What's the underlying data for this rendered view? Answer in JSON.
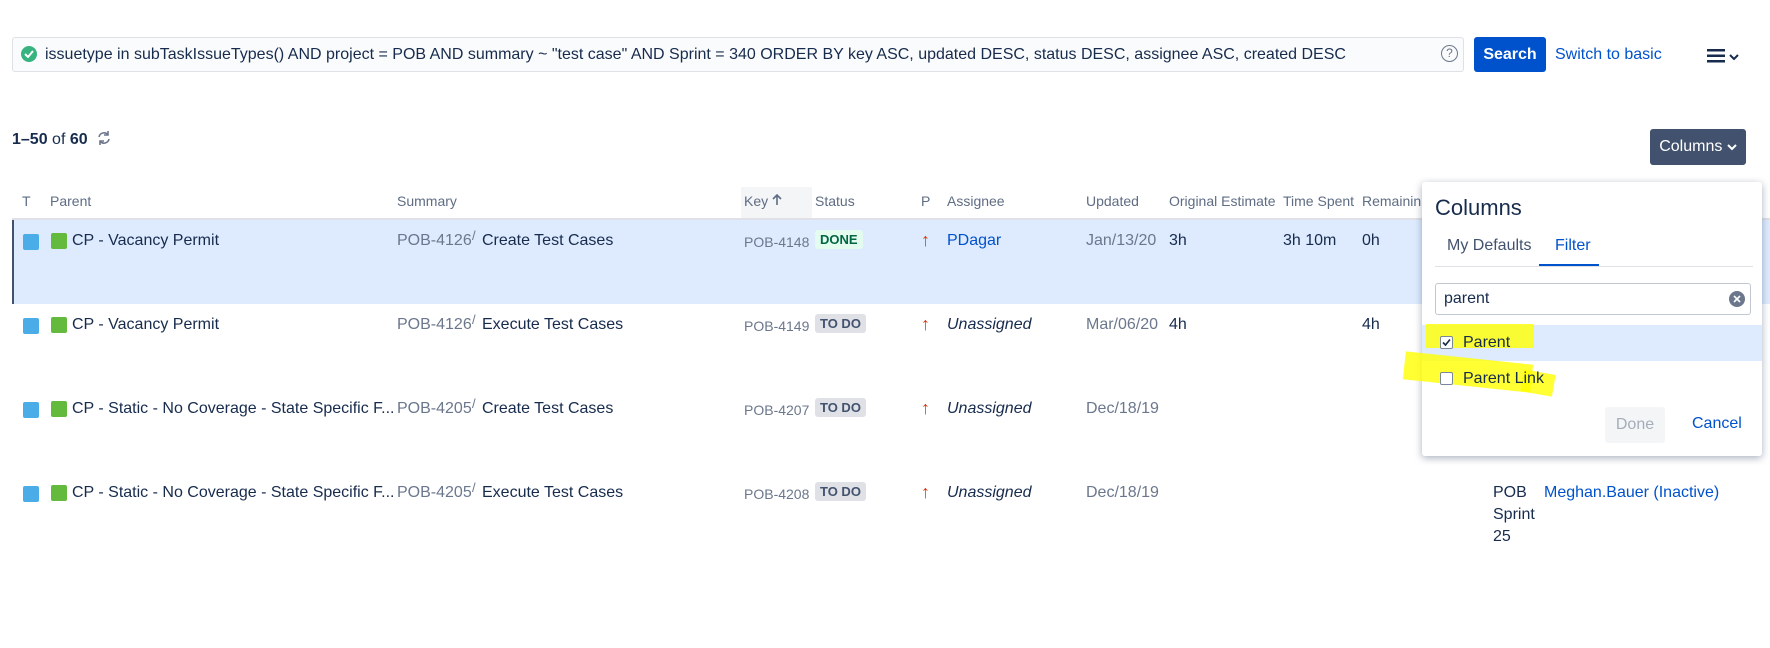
{
  "search": {
    "query": "issuetype in subTaskIssueTypes() AND project = POB AND summary ~ \"test case\" AND Sprint = 340 ORDER BY key ASC, updated DESC, status DESC, assignee ASC, created DESC",
    "help": "?",
    "search_label": "Search",
    "switch_label": "Switch to basic"
  },
  "results": {
    "range": "1–50",
    "of": "of",
    "total": "60"
  },
  "columns_button": "Columns",
  "table": {
    "headers": {
      "t": "T",
      "parent": "Parent",
      "summary": "Summary",
      "key": "Key",
      "status": "Status",
      "p": "P",
      "assignee": "Assignee",
      "updated": "Updated",
      "original_estimate": "Original Estimate",
      "time_spent": "Time Spent",
      "remaining": "Remainin"
    },
    "rows": [
      {
        "parent": "CP - Vacancy Permit",
        "parent_key": "POB-4126",
        "sep": "/",
        "summary": "Create Test Cases",
        "key": "POB-4148",
        "status": "DONE",
        "assignee": "PDagar",
        "updated": "Jan/13/20",
        "original_estimate": "3h",
        "time_spent": "3h 10m",
        "remaining": "0h"
      },
      {
        "parent": "CP - Vacancy Permit",
        "parent_key": "POB-4126",
        "sep": "/",
        "summary": "Execute Test Cases",
        "key": "POB-4149",
        "status": "TO DO",
        "assignee": "Unassigned",
        "updated": "Mar/06/20",
        "original_estimate": "4h",
        "time_spent": "",
        "remaining": "4h"
      },
      {
        "parent": "CP - Static - No Coverage - State Specific F...",
        "parent_key": "POB-4205",
        "sep": "/",
        "summary": "Create Test Cases",
        "key": "POB-4207",
        "status": "TO DO",
        "assignee": "Unassigned",
        "updated": "Dec/18/19",
        "original_estimate": "",
        "time_spent": "",
        "remaining": ""
      },
      {
        "parent": "CP - Static - No Coverage - State Specific F...",
        "parent_key": "POB-4205",
        "sep": "/",
        "summary": "Execute Test Cases",
        "key": "POB-4208",
        "status": "TO DO",
        "assignee": "Unassigned",
        "updated": "Dec/18/19",
        "original_estimate": "",
        "time_spent": "",
        "remaining": "",
        "sprint_lines": [
          "POB",
          "Sprint",
          "25"
        ],
        "reporter": "Meghan.Bauer (Inactive)"
      }
    ]
  },
  "columns_popup": {
    "title": "Columns",
    "tabs": [
      "My Defaults",
      "Filter"
    ],
    "search_value": "parent",
    "options": [
      {
        "label": "Parent",
        "checked": true
      },
      {
        "label": "Parent Link",
        "checked": false
      }
    ],
    "done_label": "Done",
    "cancel_label": "Cancel"
  },
  "colors": {
    "primary": "#0052cc",
    "highlight": "#ffff00",
    "done": "#006644",
    "priority": "#de350b"
  }
}
